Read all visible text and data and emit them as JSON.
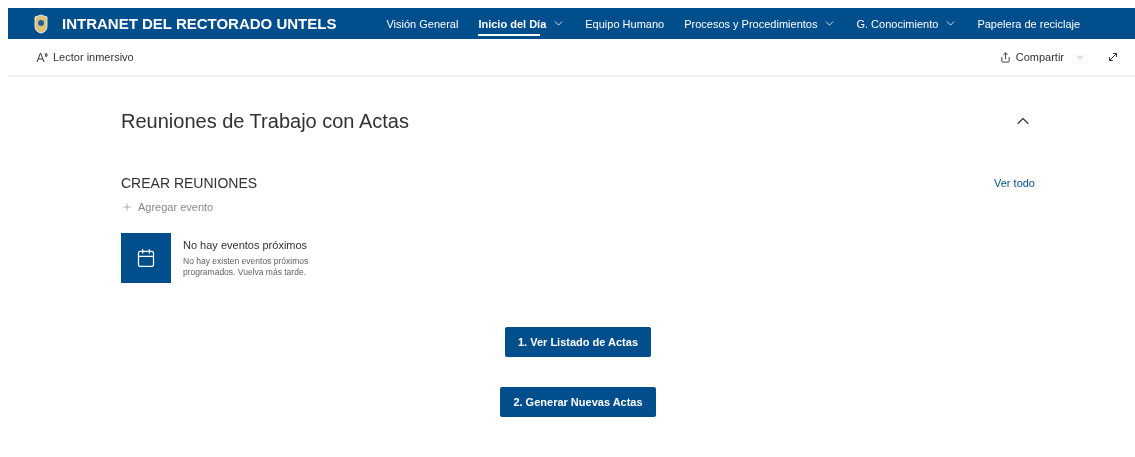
{
  "site": {
    "title": "INTRANET DEL RECTORADO UNTELS"
  },
  "nav": [
    {
      "label": "Visión General",
      "selected": false,
      "dropdown": false
    },
    {
      "label": "Inicio del Día",
      "selected": true,
      "dropdown": true
    },
    {
      "label": "Equipo Humano",
      "selected": false,
      "dropdown": false
    },
    {
      "label": "Procesos y Procedimientos",
      "selected": false,
      "dropdown": true
    },
    {
      "label": "G. Conocimiento",
      "selected": false,
      "dropdown": true
    },
    {
      "label": "Papelera de reciclaje",
      "selected": false,
      "dropdown": false
    }
  ],
  "toolbar": {
    "reader": "Lector inmersivo",
    "share": "Compartir"
  },
  "section": {
    "title": "Reuniones de Trabajo con Actas",
    "expanded": true
  },
  "events": {
    "title": "CREAR REUNIONES",
    "see_all": "Ver todo",
    "add": "Agregar evento",
    "empty_title": "No hay eventos próximos",
    "empty_text": "No hay existen eventos próximos programados. Vuelva más tarde."
  },
  "buttons": [
    "1. Ver Listado de Actas",
    "2. Generar Nuevas Actas"
  ]
}
